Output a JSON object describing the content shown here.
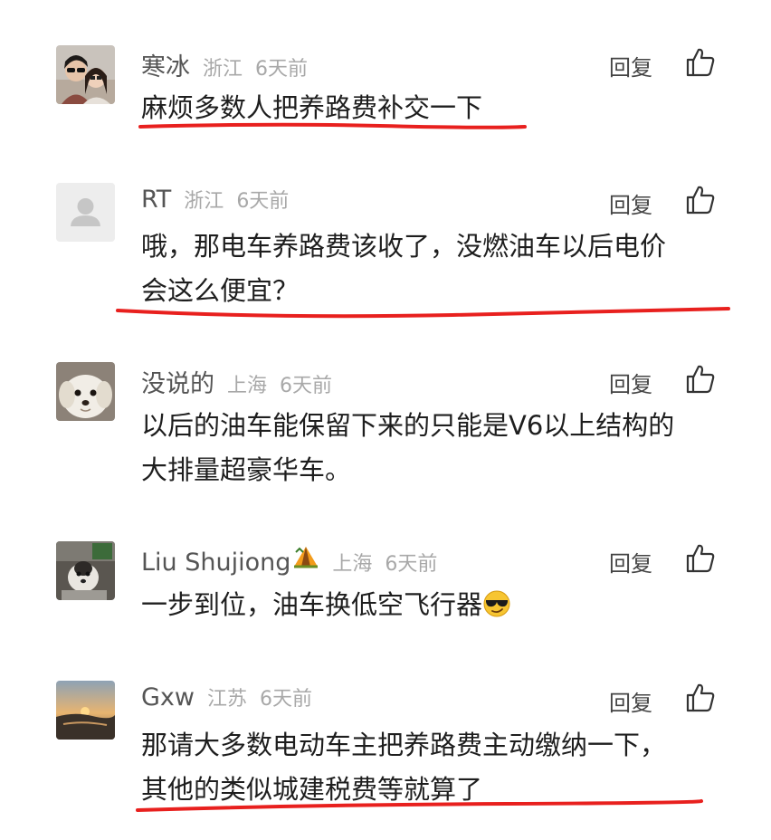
{
  "comments": [
    {
      "username": "寒冰",
      "location": "浙江",
      "time": "6天前",
      "reply_label": "回复",
      "lines": [
        "麻烦多数人把养路费补交一下"
      ],
      "avatar": "couple-photo-avatar"
    },
    {
      "username": "RT",
      "location": "浙江",
      "time": "6天前",
      "reply_label": "回复",
      "lines": [
        "哦，那电车养路费该收了，没燃油车以后电价",
        "会这么便宜？"
      ],
      "avatar": "default-person-avatar"
    },
    {
      "username": "没说的",
      "location": "上海",
      "time": "6天前",
      "reply_label": "回复",
      "lines": [
        "以后的油车能保留下来的只能是V6以上结构的",
        "大排量超豪华车。"
      ],
      "avatar": "white-dog-avatar"
    },
    {
      "username": "Liu Shujiong",
      "location": "上海",
      "time": "6天前",
      "reply_label": "回复",
      "lines": [
        "一步到位，油车换低空飞行器"
      ],
      "avatar": "dog-photo-avatar",
      "name_badge": "camping-tent-icon",
      "content_emoji": "sunglasses-emoji"
    },
    {
      "username": "Gxw",
      "location": "江苏",
      "time": "6天前",
      "reply_label": "回复",
      "lines": [
        "那请大多数电动车主把养路费主动缴纳一下，",
        "其他的类似城建税费等就算了"
      ],
      "avatar": "sunset-photo-avatar"
    }
  ],
  "colors": {
    "annotation_underline": "#e8201e",
    "meta_gray": "#a8a8a8",
    "username_gray": "#555555"
  }
}
